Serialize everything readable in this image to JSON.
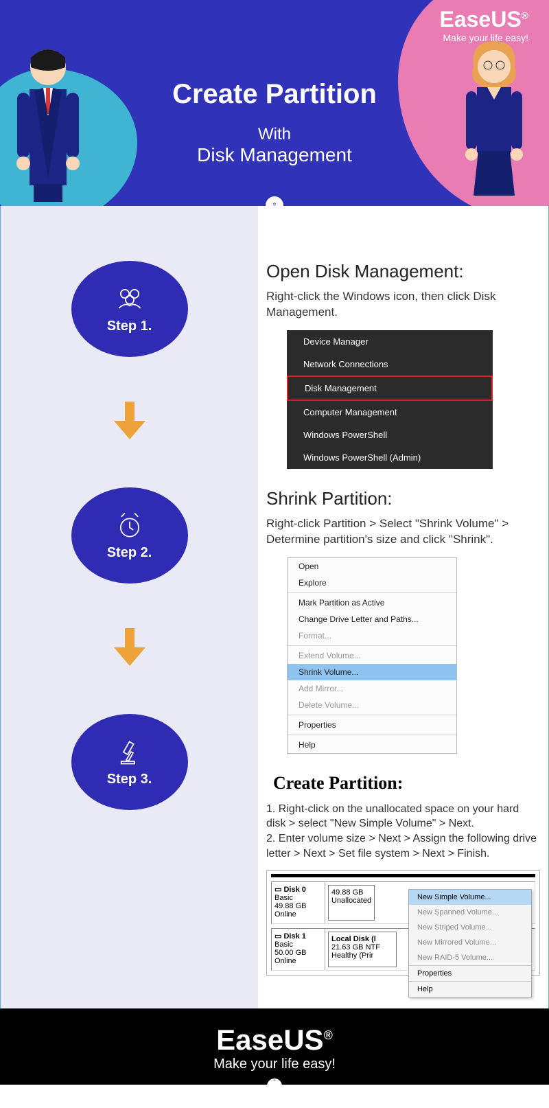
{
  "brand": {
    "name": "EaseUS",
    "reg": "®",
    "tagline": "Make your life easy!"
  },
  "header": {
    "title": "Create Partition",
    "sub1": "With",
    "sub2": "Disk Management"
  },
  "steps": {
    "s1": {
      "badge": "Step 1.",
      "title": "Open Disk Management:",
      "desc": "Right-click the Windows icon, then click Disk Management."
    },
    "s2": {
      "badge": "Step 2.",
      "title": "Shrink Partition:",
      "desc": "Right-click Partition > Select \"Shrink Volume\" > Determine partition's size and click \"Shrink\"."
    },
    "s3": {
      "badge": "Step 3.",
      "title": "Create Partition:",
      "li1": "1. Right-click on the unallocated space on your hard disk > select \"New Simple Volume\" > Next.",
      "li2": "2. Enter volume size > Next > Assign the following drive letter > Next > Set file system > Next > Finish."
    }
  },
  "winmenu": {
    "m1": "Device Manager",
    "m2": "Network Connections",
    "m3": "Disk Management",
    "m4": "Computer Management",
    "m5": "Windows PowerShell",
    "m6": "Windows PowerShell (Admin)"
  },
  "ctxmenu": {
    "open": "Open",
    "explore": "Explore",
    "mark": "Mark Partition as Active",
    "change": "Change Drive Letter and Paths...",
    "format": "Format...",
    "extend": "Extend Volume...",
    "shrink": "Shrink Volume...",
    "mirror": "Add Mirror...",
    "delete": "Delete Volume...",
    "props": "Properties",
    "help": "Help"
  },
  "disk": {
    "d0": {
      "name": "Disk 0",
      "type": "Basic",
      "size": "49.88 GB",
      "status": "Online"
    },
    "d1": {
      "name": "Disk 1",
      "type": "Basic",
      "size": "50.00 GB",
      "status": "Online"
    },
    "unalloc": {
      "size": "49.88 GB",
      "label": "Unallocated"
    },
    "local": {
      "name": "Local Disk  (I",
      "size": "21.63 GB NTF",
      "health": "Healthy (Prir"
    }
  },
  "ctxmenu2": {
    "simple": "New Simple Volume...",
    "span": "New Spanned Volume...",
    "stripe": "New Striped Volume...",
    "mirror": "New Mirrored Volume...",
    "raid": "New RAID-5 Volume...",
    "props": "Properties",
    "help": "Help"
  }
}
